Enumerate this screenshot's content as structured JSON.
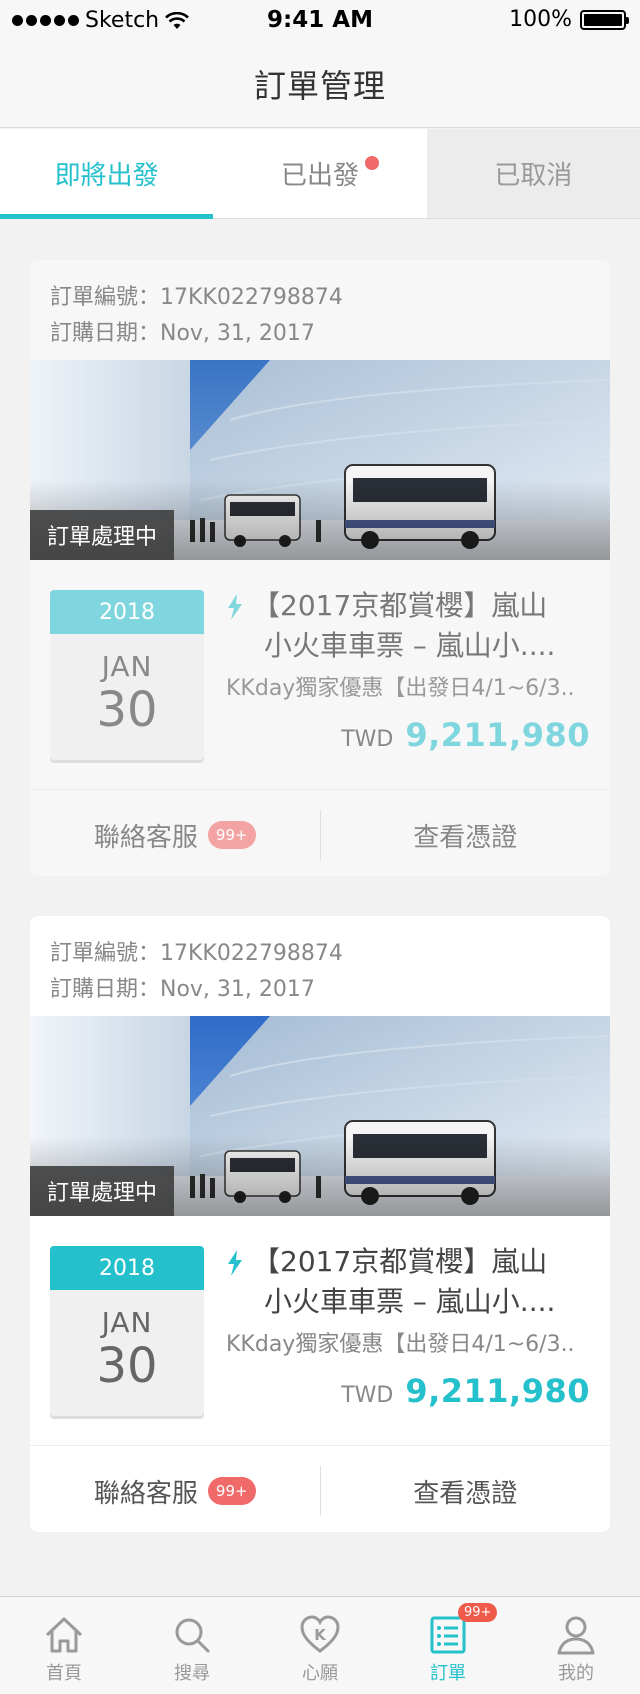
{
  "status_bar": {
    "carrier": "Sketch",
    "time": "9:41 AM",
    "battery": "100%"
  },
  "header": {
    "title": "訂單管理"
  },
  "tabs": [
    {
      "label": "即將出發",
      "state": "active"
    },
    {
      "label": "已出發",
      "state": "badge"
    },
    {
      "label": "已取消",
      "state": "disabled"
    }
  ],
  "orders": [
    {
      "order_no": "訂單編號：17KK022798874",
      "order_date": "訂購日期：Nov, 31, 2017",
      "status": "訂單處理中",
      "year": "2018",
      "month": "JAN",
      "day": "30",
      "name_line1": "【2017京都賞櫻】嵐山",
      "name_line2": "小火車車票 – 嵐山小....",
      "subtitle": "KKday獨家優惠【出發日4/1~6/3..",
      "currency": "TWD",
      "price": "9,211,980",
      "contact_label": "聯絡客服",
      "contact_badge": "99+",
      "voucher_label": "查看憑證"
    },
    {
      "order_no": "訂單編號：17KK022798874",
      "order_date": "訂購日期：Nov, 31, 2017",
      "status": "訂單處理中",
      "year": "2018",
      "month": "JAN",
      "day": "30",
      "name_line1": "【2017京都賞櫻】嵐山",
      "name_line2": "小火車車票 – 嵐山小....",
      "subtitle": "KKday獨家優惠【出發日4/1~6/3..",
      "currency": "TWD",
      "price": "9,211,980",
      "contact_label": "聯絡客服",
      "contact_badge": "99+",
      "voucher_label": "查看憑證"
    }
  ],
  "tabbar": {
    "items": [
      {
        "label": "首頁",
        "icon": "home-icon"
      },
      {
        "label": "搜尋",
        "icon": "search-icon"
      },
      {
        "label": "心願",
        "icon": "heart-icon"
      },
      {
        "label": "訂單",
        "icon": "orders-icon",
        "badge": "99+"
      },
      {
        "label": "我的",
        "icon": "profile-icon"
      }
    ]
  },
  "colors": {
    "accent": "#24c0cc",
    "accent_light": "#7fd6de",
    "badge": "#f06a6a"
  }
}
